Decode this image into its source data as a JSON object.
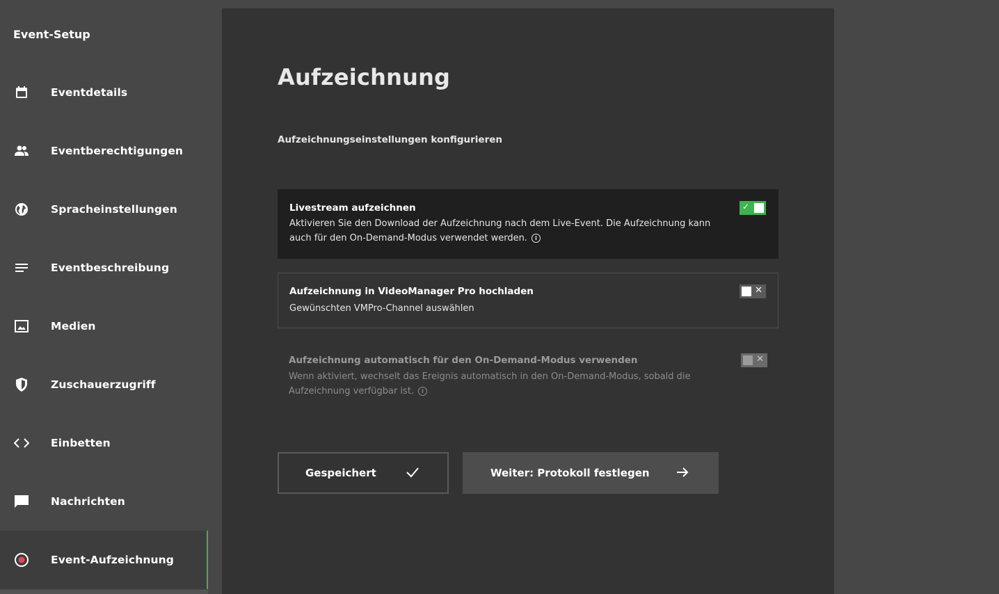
{
  "sidebar": {
    "title": "Event-Setup",
    "items": [
      {
        "label": "Eventdetails",
        "icon": "calendar-icon"
      },
      {
        "label": "Eventberechtigungen",
        "icon": "people-icon"
      },
      {
        "label": "Spracheinstellungen",
        "icon": "globe-icon"
      },
      {
        "label": "Eventbeschreibung",
        "icon": "text-lines-icon"
      },
      {
        "label": "Medien",
        "icon": "image-icon"
      },
      {
        "label": "Zuschauerzugriff",
        "icon": "shield-icon"
      },
      {
        "label": "Einbetten",
        "icon": "code-icon"
      },
      {
        "label": "Nachrichten",
        "icon": "chat-icon"
      },
      {
        "label": "Event-Aufzeichnung",
        "icon": "record-icon",
        "active": true
      }
    ]
  },
  "main": {
    "title": "Aufzeichnung",
    "subtitle": "Aufzeichnungseinstellungen konfigurieren",
    "settings": [
      {
        "title": "Livestream aufzeichnen",
        "description": "Aktivieren Sie den Download der Aufzeichnung nach dem Live-Event. Die Aufzeichnung kann auch für den On-Demand-Modus verwendet werden.",
        "enabled": true,
        "disabled": false
      },
      {
        "title": "Aufzeichnung in VideoManager Pro hochladen",
        "description": "Gewünschten VMPro-Channel auswählen",
        "enabled": false,
        "disabled": false
      },
      {
        "title": "Aufzeichnung automatisch für den On-Demand-Modus verwenden",
        "description": "Wenn aktiviert, wechselt das Ereignis automatisch in den On-Demand-Modus, sobald die Aufzeichnung verfügbar ist.",
        "enabled": false,
        "disabled": true
      }
    ],
    "buttons": {
      "saved_label": "Gespeichert",
      "next_label": "Weiter: Protokoll festlegen"
    }
  },
  "colors": {
    "accent": "#3fb34f",
    "active_record": "#e8475a"
  }
}
